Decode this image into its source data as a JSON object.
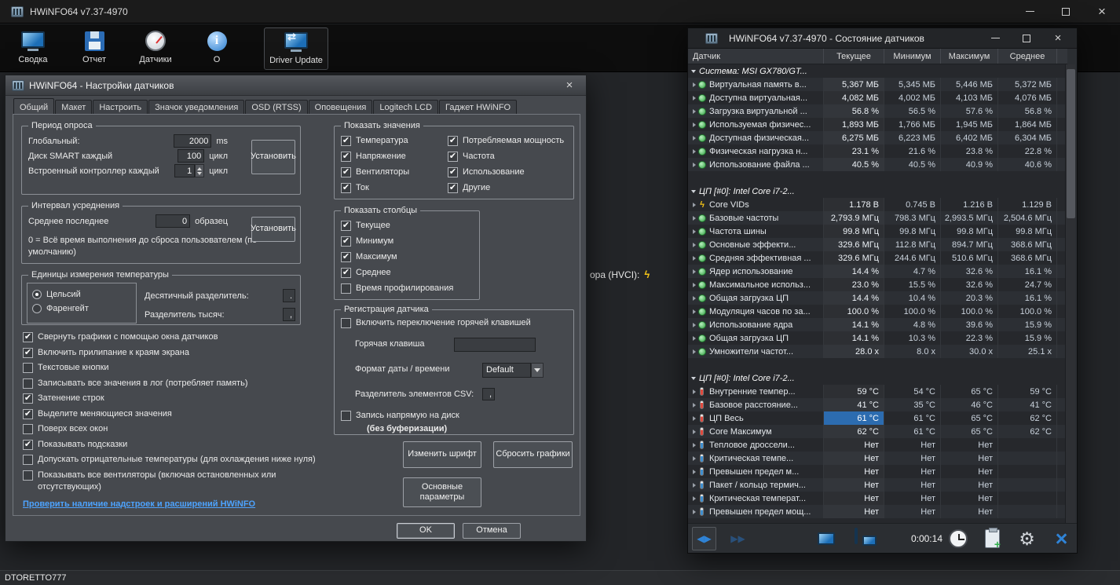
{
  "main_window": {
    "title": "HWiNFO64 v7.37-4970",
    "toolbar": [
      {
        "id": "summary",
        "label": "Сводка"
      },
      {
        "id": "report",
        "label": "Отчет"
      },
      {
        "id": "sensors",
        "label": "Датчики"
      },
      {
        "id": "about",
        "label": "О"
      },
      {
        "id": "driver-update",
        "label": "Driver Update"
      }
    ],
    "background_fragment": "ора (HVCI):",
    "status_text": "DTORETTO777"
  },
  "settings_dialog": {
    "title": "HWiNFO64 - Настройки датчиков",
    "tabs": [
      "Общий",
      "Макет",
      "Настроить",
      "Значок уведомления",
      "OSD (RTSS)",
      "Оповещения",
      "Logitech LCD",
      "Гаджет HWiNFO"
    ],
    "active_tab": "Общий",
    "polling": {
      "group_title": "Период опроса",
      "rows": [
        {
          "label": "Глобальный:",
          "value": "2000",
          "unit": "ms"
        },
        {
          "label": "Диск SMART каждый",
          "value": "100",
          "unit": "цикл"
        },
        {
          "label": "Встроенный контроллер каждый",
          "value": "1",
          "unit": "цикл"
        }
      ],
      "set_button": "Установить"
    },
    "averaging": {
      "group_title": "Интервал усреднения",
      "label": "Среднее последнее",
      "value": "0",
      "unit": "образец",
      "set_button": "Установить",
      "note": "0 = Всё время выполнения до сброса пользователем (по умолчанию)"
    },
    "temp_units": {
      "group_title": "Единицы измерения температуры",
      "options": [
        "Цельсий",
        "Фаренгейт"
      ],
      "selected": "Цельсий",
      "decimal_label": "Десятичный разделитель:",
      "decimal_value": ".",
      "thousands_label": "Разделитель тысяч:",
      "thousands_value": ","
    },
    "checkboxes": [
      {
        "label": "Свернуть графики с помощью окна датчиков",
        "checked": true
      },
      {
        "label": "Включить прилипание к краям экрана",
        "checked": true
      },
      {
        "label": "Текстовые кнопки",
        "checked": false
      },
      {
        "label": "Записывать все значения в лог (потребляет память)",
        "checked": false
      },
      {
        "label": "Затенение строк",
        "checked": true
      },
      {
        "label": "Выделите меняющиеся значения",
        "checked": true
      },
      {
        "label": "Поверх всех окон",
        "checked": false
      },
      {
        "label": "Показывать подсказки",
        "checked": true
      },
      {
        "label": "Допускать отрицательные температуры (для охлаждения ниже нуля)",
        "checked": false
      },
      {
        "label": "Показывать все вентиляторы (включая остановленных или отсутствующих)",
        "checked": false
      }
    ],
    "addons_link": "Проверить наличие надстроек и расширений HWiNFO",
    "show_values": {
      "group_title": "Показать значения",
      "items": [
        {
          "label": "Температура",
          "checked": true
        },
        {
          "label": "Потребляемая мощность",
          "checked": true
        },
        {
          "label": "Напряжение",
          "checked": true
        },
        {
          "label": "Частота",
          "checked": true
        },
        {
          "label": "Вентиляторы",
          "checked": true
        },
        {
          "label": "Использование",
          "checked": true
        },
        {
          "label": "Ток",
          "checked": true
        },
        {
          "label": "Другие",
          "checked": true
        }
      ]
    },
    "show_columns": {
      "group_title": "Показать столбцы",
      "items": [
        {
          "label": "Текущее",
          "checked": true
        },
        {
          "label": "Минимум",
          "checked": true
        },
        {
          "label": "Максимум",
          "checked": true
        },
        {
          "label": "Среднее",
          "checked": true
        },
        {
          "label": "Время профилирования",
          "checked": false
        }
      ]
    },
    "logging": {
      "group_title": "Регистрация датчика",
      "hotkey_checkbox": {
        "label": "Включить переключение горячей клавишей",
        "checked": false
      },
      "hotkey_label": "Горячая клавиша",
      "hotkey_value": "",
      "datetime_label": "Формат даты / времени",
      "datetime_value": "Default",
      "csv_label": "Разделитель элементов CSV:",
      "csv_value": ",",
      "direct_write": {
        "label": "Запись напрямую на диск",
        "note": "(без буферизации)",
        "checked": false
      }
    },
    "buttons": {
      "change_font": "Изменить шрифт",
      "reset_graphs": "Сбросить графики",
      "main_params": "Основные параметры",
      "ok": "OK",
      "cancel": "Отмена"
    }
  },
  "sensors_window": {
    "title": "HWiNFO64 v7.37-4970 - Состояние датчиков",
    "columns": [
      "Датчик",
      "Текущее",
      "Минимум",
      "Максимум",
      "Среднее"
    ],
    "footer": {
      "timer": "0:00:14"
    },
    "groups": [
      {
        "name": "Система: MSI GX780/GT...",
        "rows": [
          {
            "icon": "gauge",
            "label": "Виртуальная память в...",
            "values": [
              "5,367 МБ",
              "5,345 МБ",
              "5,446 МБ",
              "5,372 МБ"
            ]
          },
          {
            "icon": "gauge",
            "label": "Доступна виртуальная...",
            "values": [
              "4,082 МБ",
              "4,002 МБ",
              "4,103 МБ",
              "4,076 МБ"
            ]
          },
          {
            "icon": "gauge",
            "label": "Загрузка виртуальной ...",
            "values": [
              "56.8 %",
              "56.5 %",
              "57.6 %",
              "56.8 %"
            ]
          },
          {
            "icon": "gauge",
            "label": "Используемая физичес...",
            "values": [
              "1,893 МБ",
              "1,766 МБ",
              "1,945 МБ",
              "1,864 МБ"
            ]
          },
          {
            "icon": "gauge",
            "label": "Доступная физическая...",
            "values": [
              "6,275 МБ",
              "6,223 МБ",
              "6,402 МБ",
              "6,304 МБ"
            ]
          },
          {
            "icon": "gauge",
            "label": "Физическая нагрузка н...",
            "values": [
              "23.1 %",
              "21.6 %",
              "23.8 %",
              "22.8 %"
            ]
          },
          {
            "icon": "gauge",
            "label": "Использование файла ...",
            "values": [
              "40.5 %",
              "40.5 %",
              "40.9 %",
              "40.6 %"
            ]
          }
        ]
      },
      {
        "name": "ЦП [#0]: Intel Core i7-2...",
        "rows": [
          {
            "icon": "lightning",
            "label": "Core VIDs",
            "values": [
              "1.178 В",
              "0.745 В",
              "1.216 В",
              "1.129 В"
            ]
          },
          {
            "icon": "gauge",
            "label": "Базовые частоты",
            "values": [
              "2,793.9 МГц",
              "798.3 МГц",
              "2,993.5 МГц",
              "2,504.6 МГц"
            ]
          },
          {
            "icon": "gauge",
            "label": "Частота шины",
            "values": [
              "99.8 МГц",
              "99.8 МГц",
              "99.8 МГц",
              "99.8 МГц"
            ]
          },
          {
            "icon": "gauge",
            "label": "Основные эффекти...",
            "values": [
              "329.6 МГц",
              "112.8 МГц",
              "894.7 МГц",
              "368.6 МГц"
            ]
          },
          {
            "icon": "gauge",
            "label": "Средняя эффективная ...",
            "values": [
              "329.6 МГц",
              "244.6 МГц",
              "510.6 МГц",
              "368.6 МГц"
            ]
          },
          {
            "icon": "gauge",
            "label": "Ядер использование",
            "values": [
              "14.4 %",
              "4.7 %",
              "32.6 %",
              "16.1 %"
            ]
          },
          {
            "icon": "gauge",
            "label": "Максимальное использ...",
            "values": [
              "23.0 %",
              "15.5 %",
              "32.6 %",
              "24.7 %"
            ]
          },
          {
            "icon": "gauge",
            "label": "Общая загрузка ЦП",
            "values": [
              "14.4 %",
              "10.4 %",
              "20.3 %",
              "16.1 %"
            ]
          },
          {
            "icon": "gauge",
            "label": "Модуляция часов по за...",
            "values": [
              "100.0 %",
              "100.0 %",
              "100.0 %",
              "100.0 %"
            ]
          },
          {
            "icon": "gauge",
            "label": "Использование ядра",
            "values": [
              "14.1 %",
              "4.8 %",
              "39.6 %",
              "15.9 %"
            ]
          },
          {
            "icon": "gauge",
            "label": "Общая загрузка ЦП",
            "values": [
              "14.1 %",
              "10.3 %",
              "22.3 %",
              "15.9 %"
            ]
          },
          {
            "icon": "gauge",
            "label": "Умножители частот...",
            "values": [
              "28.0 x",
              "8.0 x",
              "30.0 x",
              "25.1 x"
            ]
          }
        ]
      },
      {
        "name": "ЦП [#0]: Intel Core i7-2...",
        "rows": [
          {
            "icon": "thermo-red",
            "label": "Внутренние темпер...",
            "values": [
              "59 °C",
              "54 °C",
              "65 °C",
              "59 °C"
            ]
          },
          {
            "icon": "thermo-red",
            "label": "Базовое расстояние...",
            "values": [
              "41 °C",
              "35 °C",
              "46 °C",
              "41 °C"
            ]
          },
          {
            "icon": "thermo-red",
            "label": "ЦП Весь",
            "values": [
              "61 °C",
              "61 °C",
              "65 °C",
              "62 °C"
            ],
            "highlight": 0
          },
          {
            "icon": "thermo-red",
            "label": "Core Максимум",
            "values": [
              "62 °C",
              "61 °C",
              "65 °C",
              "62 °C"
            ]
          },
          {
            "icon": "thermo-blue",
            "label": "Тепловое дроссели...",
            "values": [
              "Нет",
              "Нет",
              "Нет",
              ""
            ]
          },
          {
            "icon": "thermo-blue",
            "label": "Критическая темпе...",
            "values": [
              "Нет",
              "Нет",
              "Нет",
              ""
            ]
          },
          {
            "icon": "thermo-blue",
            "label": "Превышен предел м...",
            "values": [
              "Нет",
              "Нет",
              "Нет",
              ""
            ]
          },
          {
            "icon": "thermo-blue",
            "label": "Пакет / кольцо термич...",
            "values": [
              "Нет",
              "Нет",
              "Нет",
              ""
            ]
          },
          {
            "icon": "thermo-blue",
            "label": "Критическая температ...",
            "values": [
              "Нет",
              "Нет",
              "Нет",
              ""
            ]
          },
          {
            "icon": "thermo-blue",
            "label": "Превышен предел мощ...",
            "values": [
              "Нет",
              "Нет",
              "Нет",
              ""
            ]
          }
        ]
      }
    ]
  }
}
